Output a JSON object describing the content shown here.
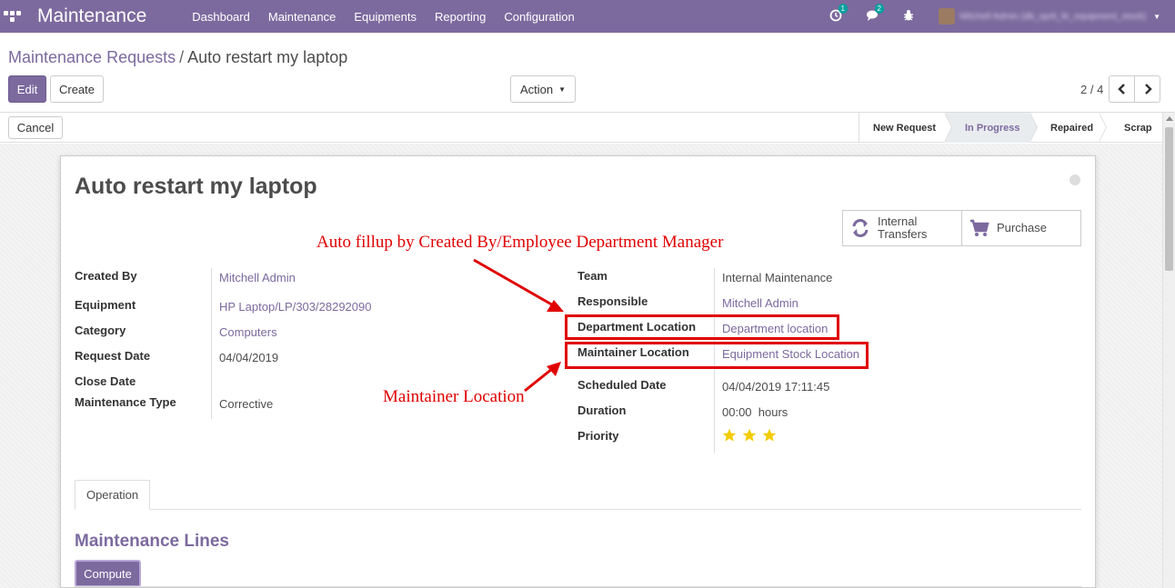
{
  "navbar": {
    "brand": "Maintenance",
    "menu": [
      "Dashboard",
      "Maintenance",
      "Equipments",
      "Reporting",
      "Configuration"
    ],
    "activity_count": "1",
    "message_count": "2",
    "user": "Mitchell Admin (db_sprit_fe_equipment_stock)"
  },
  "breadcrumb": {
    "parent": "Maintenance Requests",
    "separator": "/",
    "current": "Auto restart my laptop"
  },
  "buttons": {
    "edit": "Edit",
    "create": "Create",
    "action": "Action",
    "cancel": "Cancel",
    "compute": "Compute"
  },
  "pager": {
    "value": "2 / 4"
  },
  "stages": [
    {
      "label": "New Request",
      "active": false
    },
    {
      "label": "In Progress",
      "active": true
    },
    {
      "label": "Repaired",
      "active": false
    },
    {
      "label": "Scrap",
      "active": false
    }
  ],
  "record": {
    "title": "Auto restart my laptop",
    "smart_buttons": {
      "internal_transfers_line1": "Internal",
      "internal_transfers_line2": "Transfers",
      "purchase": "Purchase"
    },
    "left_fields": [
      {
        "label": "Created By",
        "value": "Mitchell Admin",
        "link": true
      },
      {
        "label": "Equipment",
        "value": "HP Laptop/LP/303/28292090",
        "link": true
      },
      {
        "label": "Category",
        "value": "Computers",
        "link": true
      },
      {
        "label": "Request Date",
        "value": "04/04/2019",
        "link": false
      },
      {
        "label": "Close Date",
        "value": "",
        "link": false
      },
      {
        "label": "Maintenance Type",
        "value": "Corrective",
        "link": false
      }
    ],
    "right_fields": [
      {
        "label": "Team",
        "value": "Internal Maintenance",
        "link": false
      },
      {
        "label": "Responsible",
        "value": "Mitchell Admin",
        "link": true
      },
      {
        "label": "Department Location",
        "value": "Department location",
        "link": true
      },
      {
        "label": "Maintainer Location",
        "value": "Equipment Stock Location",
        "link": true
      },
      {
        "label": "Scheduled Date",
        "value": "04/04/2019 17:11:45",
        "link": false
      },
      {
        "label": "Duration",
        "value": "00:00  hours",
        "link": false
      },
      {
        "label": "Priority",
        "value": "",
        "link": false
      }
    ],
    "priority_stars": 3
  },
  "annotations": {
    "top": "Auto fillup by Created By/Employee Department Manager",
    "bottom": "Maintainer Location"
  },
  "tabs": [
    "Operation"
  ],
  "section": {
    "title": "Maintenance Lines"
  },
  "colors": {
    "brand": "#7c6a9e",
    "annotation": "#e00000",
    "star": "#f3cc00"
  },
  "icons": [
    "apps-icon",
    "activity-clock-icon",
    "chat-icon",
    "bug-icon",
    "caret-down-icon",
    "chevron-left-icon",
    "chevron-right-icon",
    "refresh-icon",
    "cart-icon",
    "star-icon"
  ]
}
